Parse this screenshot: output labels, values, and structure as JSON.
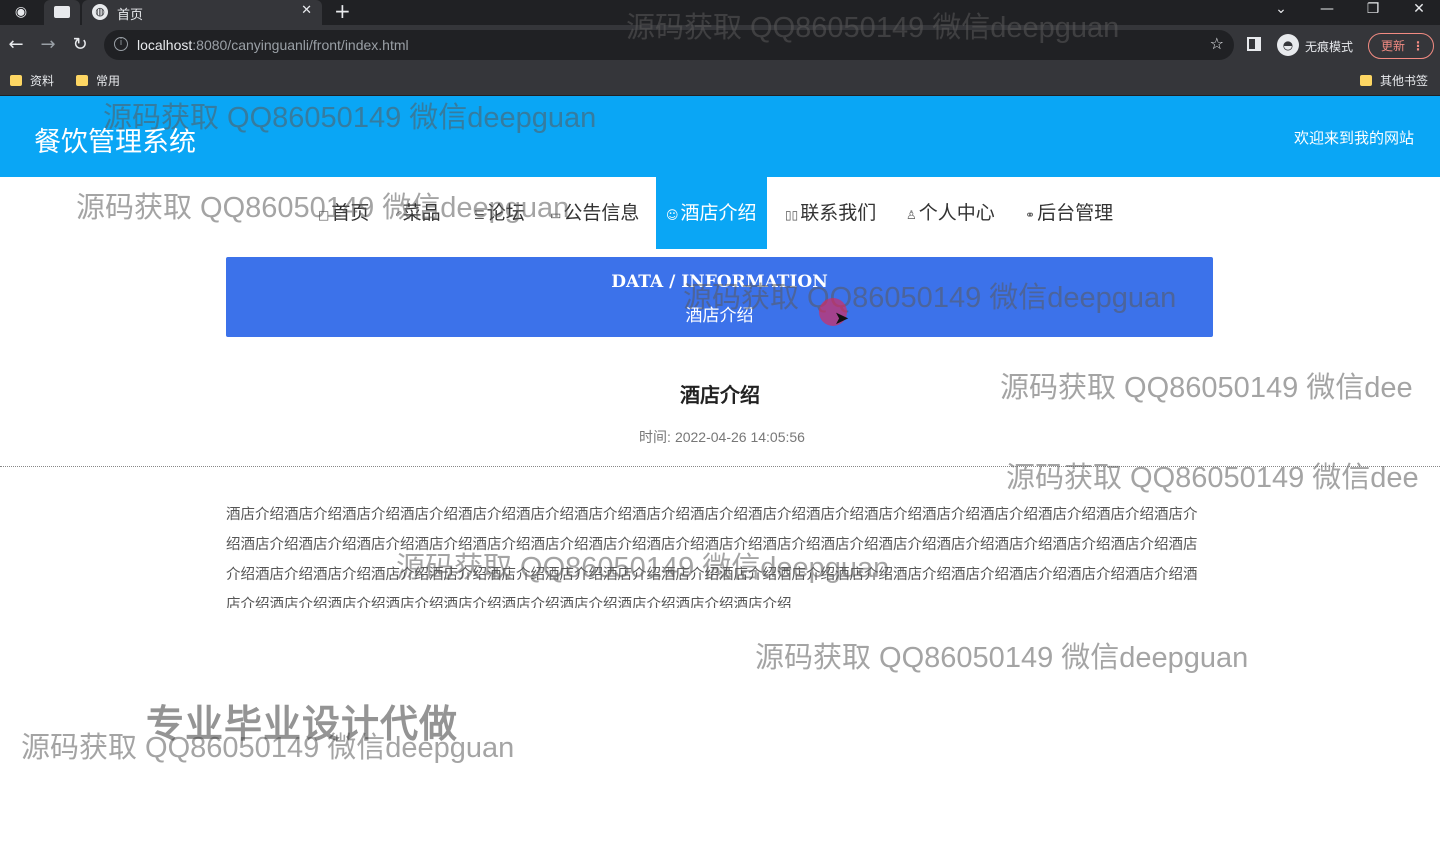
{
  "browser": {
    "tab_title": "首页",
    "new_tab_label": "+",
    "url_host": "localhost",
    "url_rest": ":8080/canyinguanli/front/index.html",
    "incognito_label": "无痕模式",
    "update_label": "更新",
    "bookmarks": [
      "资料",
      "常用"
    ],
    "other_bookmarks": "其他书签"
  },
  "header": {
    "title": "餐饮管理系统",
    "welcome": "欢迎来到我的网站"
  },
  "nav": {
    "items": [
      {
        "label": "首页",
        "icon": "home-icon"
      },
      {
        "label": "菜品",
        "icon": "dish-icon"
      },
      {
        "label": "论坛",
        "icon": "forum-icon"
      },
      {
        "label": "公告信息",
        "icon": "notice-icon"
      },
      {
        "label": "酒店介绍",
        "icon": "hotel-icon",
        "active": true
      },
      {
        "label": "联系我们",
        "icon": "contact-icon"
      },
      {
        "label": "个人中心",
        "icon": "user-icon"
      },
      {
        "label": "后台管理",
        "icon": "link-icon"
      }
    ]
  },
  "banner": {
    "english": "DATA / INFORMATION",
    "chinese": "酒店介绍"
  },
  "article": {
    "title": "酒店介绍",
    "time_label": "时间:",
    "time_value": "2022-04-26 14:05:56",
    "body": "酒店介绍酒店介绍酒店介绍酒店介绍酒店介绍酒店介绍酒店介绍酒店介绍酒店介绍酒店介绍酒店介绍酒店介绍酒店介绍酒店介绍酒店介绍酒店介绍酒店介绍酒店介绍酒店介绍酒店介绍酒店介绍酒店介绍酒店介绍酒店介绍酒店介绍酒店介绍酒店介绍酒店介绍酒店介绍酒店介绍酒店介绍酒店介绍酒店介绍酒店介绍酒店介绍酒店介绍酒店介绍酒店介绍酒店介绍酒店介绍酒店介绍酒店介绍酒店介绍酒店介绍酒店介绍酒店介绍酒店介绍酒店介绍酒店介绍酒店介绍酒店介绍酒店介绍酒店介绍酒店介绍酒店介绍酒店介绍酒店介绍酒店介绍酒店介绍酒店介绍"
  },
  "watermarks": {
    "text": "源码获取 QQ86050149 微信deepguan",
    "cut_text": "源码获取 QQ86050149 微信dee",
    "big": "专业毕业设计代做"
  },
  "colors": {
    "header_bg": "#0aa6f5",
    "banner_bg": "#3c72ea",
    "active_nav_bg": "#0aa6f5"
  }
}
